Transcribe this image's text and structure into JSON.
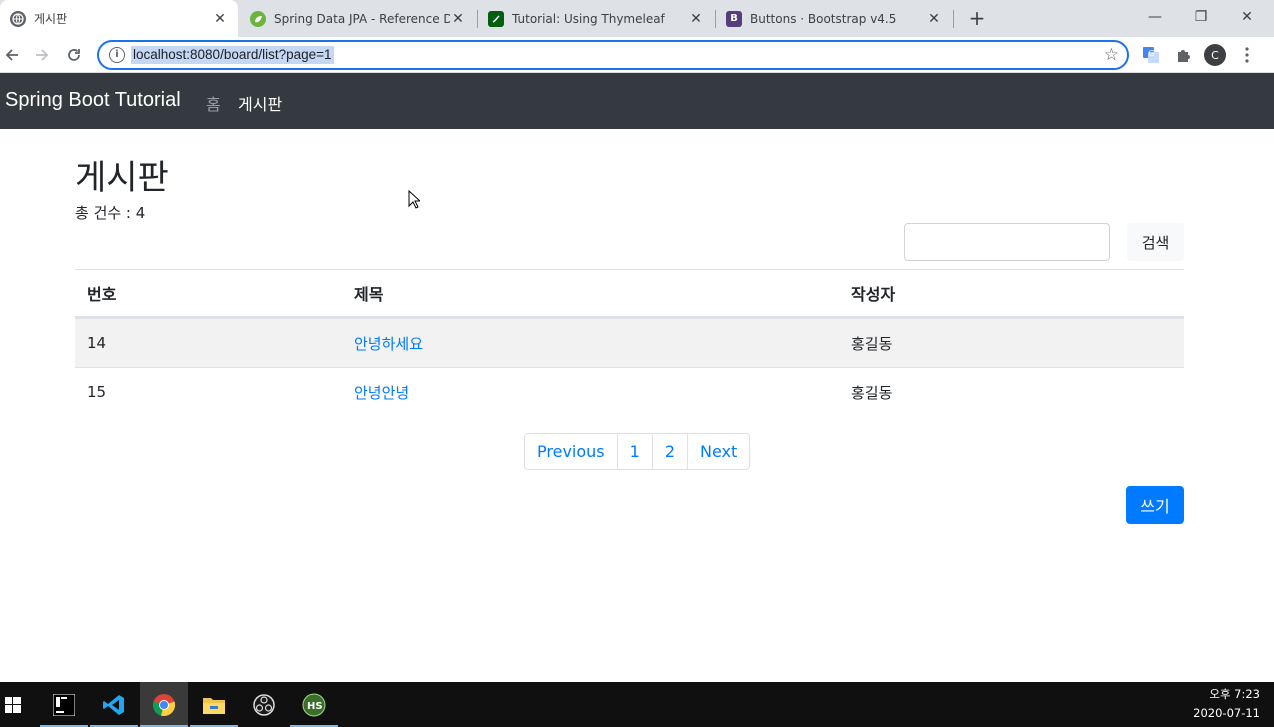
{
  "browser": {
    "tabs": [
      {
        "title": "게시판"
      },
      {
        "title": "Spring Data JPA - Reference Do"
      },
      {
        "title": "Tutorial: Using Thymeleaf"
      },
      {
        "title": "Buttons · Bootstrap v4.5"
      }
    ],
    "url": "localhost:8080/board/list?page=1",
    "profile_initial": "C"
  },
  "navbar": {
    "brand": "Spring Boot Tutorial",
    "links": [
      {
        "label": "홈",
        "active": false
      },
      {
        "label": "게시판",
        "active": true
      }
    ]
  },
  "main": {
    "title": "게시판",
    "count_label": "총 건수 : 4",
    "search_button": "검색",
    "table": {
      "headers": [
        "번호",
        "제목",
        "작성자"
      ],
      "rows": [
        {
          "id": "14",
          "title": "안녕하세요",
          "author": "홍길동"
        },
        {
          "id": "15",
          "title": "안녕안녕",
          "author": "홍길동"
        }
      ]
    },
    "pagination": [
      "Previous",
      "1",
      "2",
      "Next"
    ],
    "write_button": "쓰기"
  },
  "taskbar": {
    "time": "오후 7:23",
    "date": "2020-07-11"
  },
  "colors": {
    "primary": "#007bff",
    "navbar_bg": "#343a40",
    "tab_bar": "#dee1e6"
  }
}
